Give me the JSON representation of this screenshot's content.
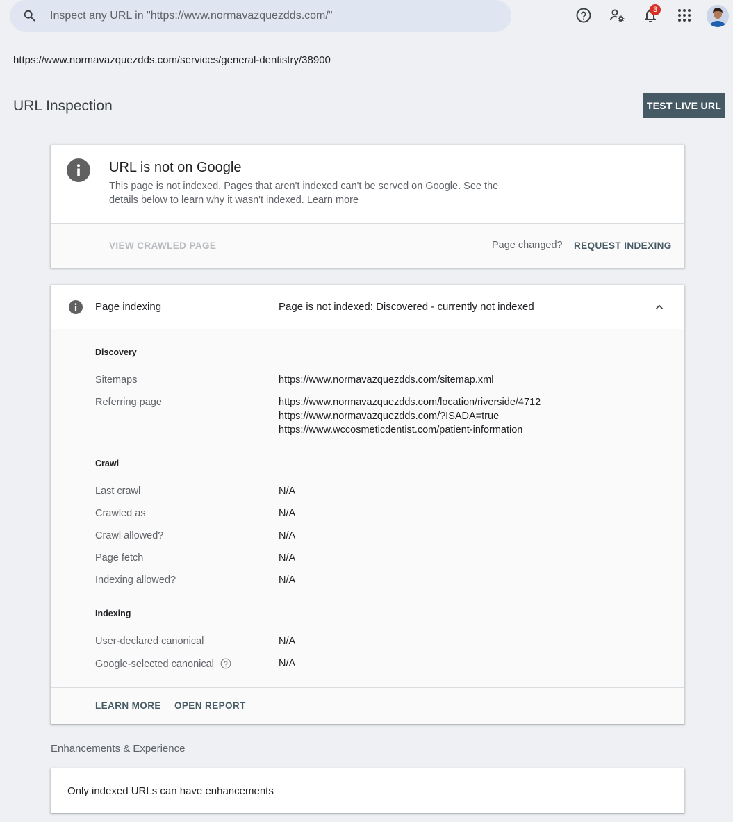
{
  "search": {
    "placeholder": "Inspect any URL in \"https://www.normavazquezdds.com/\""
  },
  "topbar": {
    "icons": [
      "help-icon",
      "manage-users-icon",
      "notifications-icon",
      "apps-icon"
    ],
    "notification_count": "3"
  },
  "inspected_url": "https://www.normavazquezdds.com/services/general-dentistry/38900",
  "page_title": "URL Inspection",
  "test_live_url": "TEST LIVE URL",
  "status_card": {
    "title": "URL is not on Google",
    "description": "This page is not indexed. Pages that aren't indexed can't be served on Google. See the details below to learn why it wasn't indexed.",
    "learn_more": "Learn more",
    "view_crawled_page": "VIEW CRAWLED PAGE",
    "page_changed": "Page changed?",
    "request_indexing": "REQUEST INDEXING"
  },
  "indexing_card": {
    "label": "Page indexing",
    "value": "Page is not indexed: Discovered - currently not indexed",
    "discovery": {
      "heading": "Discovery",
      "sitemaps_label": "Sitemaps",
      "sitemaps_value": "https://www.normavazquezdds.com/sitemap.xml",
      "referring_label": "Referring page",
      "referring_values": [
        "https://www.normavazquezdds.com/location/riverside/4712",
        "https://www.normavazquezdds.com/?ISADA=true",
        "https://www.wccosmeticdentist.com/patient-information"
      ]
    },
    "crawl": {
      "heading": "Crawl",
      "rows": [
        {
          "label": "Last crawl",
          "value": "N/A"
        },
        {
          "label": "Crawled as",
          "value": "N/A"
        },
        {
          "label": "Crawl allowed?",
          "value": "N/A"
        },
        {
          "label": "Page fetch",
          "value": "N/A"
        },
        {
          "label": "Indexing allowed?",
          "value": "N/A"
        }
      ]
    },
    "indexing": {
      "heading": "Indexing",
      "rows": [
        {
          "label": "User-declared canonical",
          "value": "N/A"
        },
        {
          "label": "Google-selected canonical",
          "value": "N/A"
        }
      ]
    },
    "learn_more": "LEARN MORE",
    "open_report": "OPEN REPORT"
  },
  "enhancements": {
    "title": "Enhancements & Experience",
    "message": "Only indexed URLs can have enhancements"
  },
  "colors": {
    "accent": "#455a64",
    "background": "#eef0f3",
    "badge": "#d93025"
  }
}
